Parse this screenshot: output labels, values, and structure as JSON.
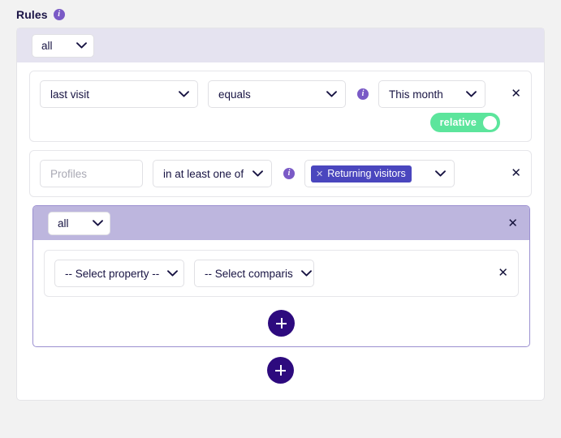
{
  "header": {
    "title": "Rules",
    "info_icon": "info-icon"
  },
  "root_group": {
    "match_label": "all",
    "rules": [
      {
        "property": "last visit",
        "comparison": "equals",
        "value": "This month",
        "info_icon": "info-icon",
        "toggle_label": "relative",
        "toggle_on": "true",
        "remove_label": "✕"
      },
      {
        "property_placeholder": "Profiles",
        "property_value": "",
        "comparison": "in at least one of",
        "info_icon": "info-icon",
        "chip_label": "Returning visitors",
        "chip_remove": "✕",
        "remove_label": "✕"
      }
    ],
    "nested_group": {
      "match_label": "all",
      "remove_label": "✕",
      "rules": [
        {
          "property": "-- Select property --",
          "comparison": "-- Select comparis",
          "remove_label": "✕"
        }
      ],
      "add_button_label": "+"
    },
    "add_button_label": "+"
  },
  "colors": {
    "page_background": "#f2f2f2",
    "panel_background": "#ffffff",
    "group_header": "#e5e3f0",
    "nested_group_header": "#bdb6de",
    "nested_group_border": "#9b90d0",
    "accent_dark": "#2d0a7e",
    "chip": "#4a46be",
    "toggle_on": "#5ce59c",
    "info_icon": "#7a5ac6",
    "text": "#181443"
  }
}
